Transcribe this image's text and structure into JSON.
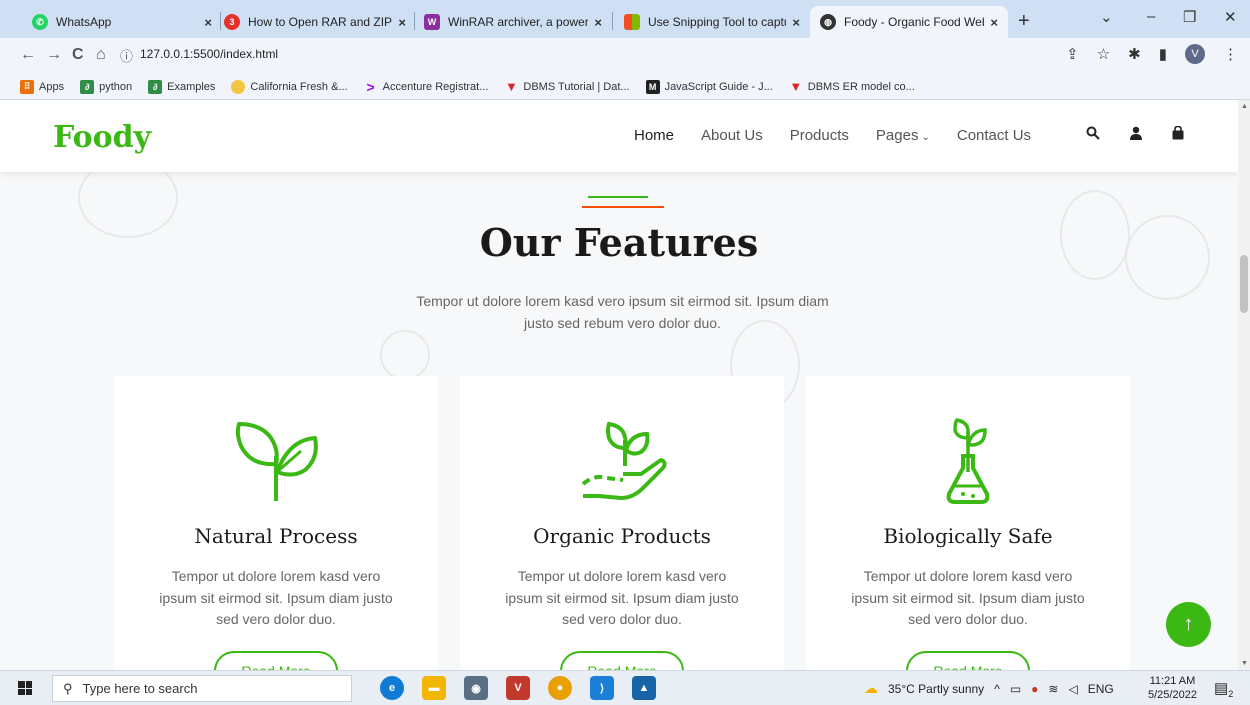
{
  "browser": {
    "tabs": [
      {
        "title": "WhatsApp",
        "icon": "whatsapp-icon",
        "color": "#25d366",
        "active": false
      },
      {
        "title": "How to Open RAR and ZIP Fi",
        "icon": "360-icon",
        "color": "#e4322b",
        "active": false
      },
      {
        "title": "WinRAR archiver, a powerful",
        "icon": "winrar-icon",
        "color": "#8b2fa0",
        "active": false
      },
      {
        "title": "Use Snipping Tool to capture",
        "icon": "microsoft-icon",
        "color": "#f25022",
        "active": false
      },
      {
        "title": "Foody - Organic Food Websi",
        "icon": "globe-icon",
        "color": "#333333",
        "active": true
      }
    ],
    "url_info": "ⓘ",
    "url": "127.0.0.1:5500/index.html",
    "profile_initial": "V",
    "bookmarks": [
      {
        "label": "Apps",
        "icon": "apps-grid-icon",
        "color": "#e8710a"
      },
      {
        "label": "python",
        "icon": "geeks-icon",
        "color": "#2f8d46"
      },
      {
        "label": "Examples",
        "icon": "geeks-icon",
        "color": "#2f8d46"
      },
      {
        "label": "California Fresh &...",
        "icon": "california-icon",
        "color": "#f4c542"
      },
      {
        "label": "Accenture Registrat...",
        "icon": "accenture-icon",
        "color": "#a100ff"
      },
      {
        "label": "DBMS Tutorial | Dat...",
        "icon": "tutorial-icon",
        "color": "#e02424"
      },
      {
        "label": "JavaScript Guide - J...",
        "icon": "mdn-icon",
        "color": "#222222"
      },
      {
        "label": "DBMS ER model co...",
        "icon": "tutorial-icon",
        "color": "#e02424"
      }
    ]
  },
  "site": {
    "logo": "Foody",
    "nav": [
      {
        "label": "Home",
        "active": true
      },
      {
        "label": "About Us"
      },
      {
        "label": "Products"
      },
      {
        "label": "Pages",
        "dropdown": true
      },
      {
        "label": "Contact Us"
      }
    ],
    "pages_caret": "⌄",
    "header_icons": [
      "search-icon",
      "user-icon",
      "shopping-bag-icon"
    ]
  },
  "features": {
    "title": "Our Features",
    "subtitle": "Tempor ut dolore lorem kasd vero ipsum sit eirmod sit. Ipsum diam justo sed rebum vero dolor duo.",
    "cards": [
      {
        "icon": "sprout-icon",
        "title": "Natural Process",
        "text": "Tempor ut dolore lorem kasd vero ipsum sit eirmod sit. Ipsum diam justo sed vero dolor duo.",
        "button": "Read More"
      },
      {
        "icon": "plant-hand-icon",
        "title": "Organic Products",
        "text": "Tempor ut dolore lorem kasd vero ipsum sit eirmod sit. Ipsum diam justo sed vero dolor duo.",
        "button": "Read More"
      },
      {
        "icon": "flask-plant-icon",
        "title": "Biologically Safe",
        "text": "Tempor ut dolore lorem kasd vero ipsum sit eirmod sit. Ipsum diam justo sed vero dolor duo.",
        "button": "Read More"
      }
    ]
  },
  "colors": {
    "brand": "#3cb815",
    "accent": "#f65005"
  },
  "back_to_top": "↑",
  "taskbar": {
    "search_placeholder": "Type here to search",
    "weather": "35°C  Partly sunny",
    "language": "ENG",
    "time": "11:21 AM",
    "date": "5/25/2022",
    "notifications": "2",
    "apps": [
      {
        "icon": "edge-icon",
        "color": "#0f7bd4"
      },
      {
        "icon": "file-explorer-icon",
        "color": "#f2b705"
      },
      {
        "icon": "camera-icon",
        "color": "#5a6f86"
      },
      {
        "icon": "vs-icon",
        "color": "#c0392b"
      },
      {
        "icon": "chrome-icon",
        "color": "#e8a100"
      },
      {
        "icon": "vscode-icon",
        "color": "#1c7fd6"
      },
      {
        "icon": "photos-icon",
        "color": "#1862a8"
      }
    ]
  }
}
